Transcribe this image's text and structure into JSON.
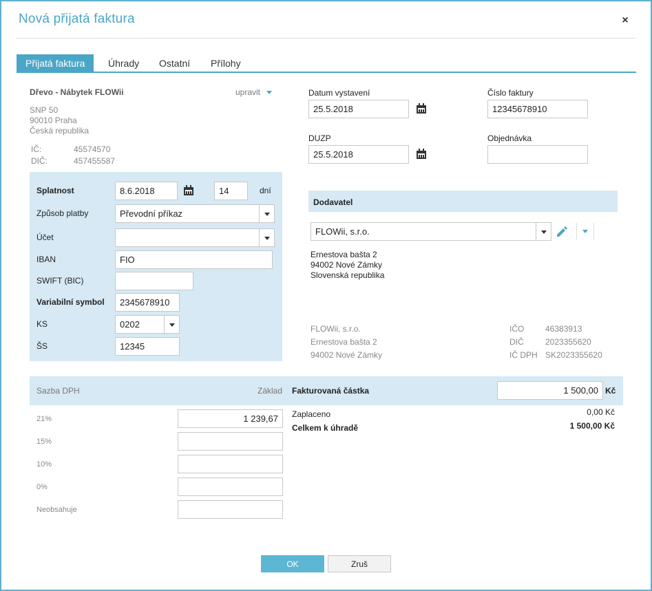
{
  "dialog": {
    "title": "Nová přijatá faktura",
    "close": "×"
  },
  "tabs": [
    {
      "label": "Přijatá faktura"
    },
    {
      "label": "Úhrady"
    },
    {
      "label": "Ostatní"
    },
    {
      "label": "Přílohy"
    }
  ],
  "company": {
    "name": "Dřevo - Nábytek FLOWii",
    "edit_label": "upravit",
    "street": "SNP 50",
    "city": "90010 Praha",
    "country": "Česká republika",
    "ico_label": "IČ:",
    "ico": "45574570",
    "dic_label": "DIČ:",
    "dic": "457455587"
  },
  "payment": {
    "splatnost_label": "Splatnost",
    "splatnost_date": "8.6.2018",
    "splatnost_days": "14",
    "days_unit": "dní",
    "zpusob_label": "Způsob platby",
    "zpusob_value": "Převodní příkaz",
    "ucet_label": "Účet",
    "ucet_value": "",
    "iban_label": "IBAN",
    "iban_value": "FIO",
    "swift_label": "SWIFT (BIC)",
    "swift_value": "",
    "vs_label": "Variabilní symbol",
    "vs_value": "2345678910",
    "ks_label": "KS",
    "ks_value": "0202",
    "ss_label": "ŠS",
    "ss_value": "12345"
  },
  "dates": {
    "datum_vystaveni_label": "Datum vystavení",
    "datum_vystaveni": "25.5.2018",
    "cislo_faktury_label": "Číslo faktury",
    "cislo_faktury": "12345678910",
    "duzp_label": "DUZP",
    "duzp": "25.5.2018",
    "objednavka_label": "Objednávka",
    "objednavka": ""
  },
  "supplier": {
    "header": "Dodavatel",
    "selected": "FLOWii, s.r.o.",
    "street": "Ernestova bašta 2",
    "city": "94002 Nové Zámky",
    "country": "Slovenská republika",
    "info_name": "FLOWii, s.r.o.",
    "info_street": "Ernestova bašta 2",
    "info_city": "94002 Nové Zámky",
    "ico_label": "IČO",
    "ico": "46383913",
    "dic_label": "DIČ",
    "dic": "2023355620",
    "icdph_label": "IČ DPH",
    "icdph": "SK2023355620"
  },
  "vat": {
    "rate_header": "Sazba DPH",
    "base_header": "Základ",
    "rows": [
      {
        "rate": "21%",
        "base": "1 239,67"
      },
      {
        "rate": "15%",
        "base": ""
      },
      {
        "rate": "10%",
        "base": ""
      },
      {
        "rate": "0%",
        "base": ""
      },
      {
        "rate": "Neobsahuje",
        "base": ""
      }
    ]
  },
  "totals": {
    "invoiced_label": "Fakturovaná částka",
    "invoiced_value": "1 500,00",
    "currency": "Kč",
    "paid_label": "Zaplaceno",
    "paid_value": "0,00 Kč",
    "total_label": "Celkem k úhradě",
    "total_value": "1 500,00 Kč"
  },
  "buttons": {
    "ok": "OK",
    "cancel": "Zruš"
  },
  "colors": {
    "accent": "#4aa6c7",
    "panel": "#d6e9f4",
    "border": "#5cb1cf"
  }
}
